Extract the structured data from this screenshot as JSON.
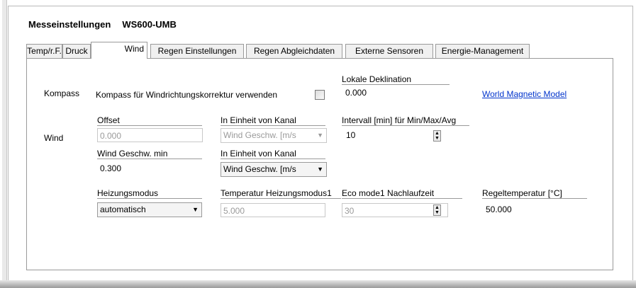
{
  "header": {
    "title": "Messeinstellungen",
    "model": "WS600-UMB"
  },
  "tabs": [
    {
      "label": "Temp/r.F."
    },
    {
      "label": "Druck"
    },
    {
      "label": "Wind"
    },
    {
      "label": "Regen Einstellungen"
    },
    {
      "label": "Regen Abgleichdaten"
    },
    {
      "label": "Externe Sensoren"
    },
    {
      "label": "Energie-Management"
    }
  ],
  "active_tab": "Wind",
  "kompass": {
    "section_label": "Kompass",
    "checkbox_label": "Kompass für Windrichtungskorrektur verwenden",
    "checked": false,
    "deklination_label": "Lokale Deklination",
    "deklination_value": "0.000",
    "link": "World Magnetic Model"
  },
  "wind": {
    "section_label": "Wind",
    "offset_label": "Offset",
    "offset_value": "0.000",
    "unit1_label": "In Einheit von Kanal",
    "unit1_value": "Wind Geschw. [m/s",
    "interval_label": "Intervall [min] für Min/Max/Avg",
    "interval_value": "10",
    "min_label": "Wind Geschw. min",
    "min_value": "0.300",
    "unit2_label": "In Einheit von Kanal",
    "unit2_value": "Wind Geschw. [m/s"
  },
  "heizung": {
    "mode_label": "Heizungsmodus",
    "mode_value": "automatisch",
    "temp_label": "Temperatur Heizungsmodus1",
    "temp_value": "5.000",
    "eco_label": "Eco mode1 Nachlaufzeit",
    "eco_value": "30",
    "regel_label": "Regeltemperatur [°C]",
    "regel_value": "50.000"
  }
}
